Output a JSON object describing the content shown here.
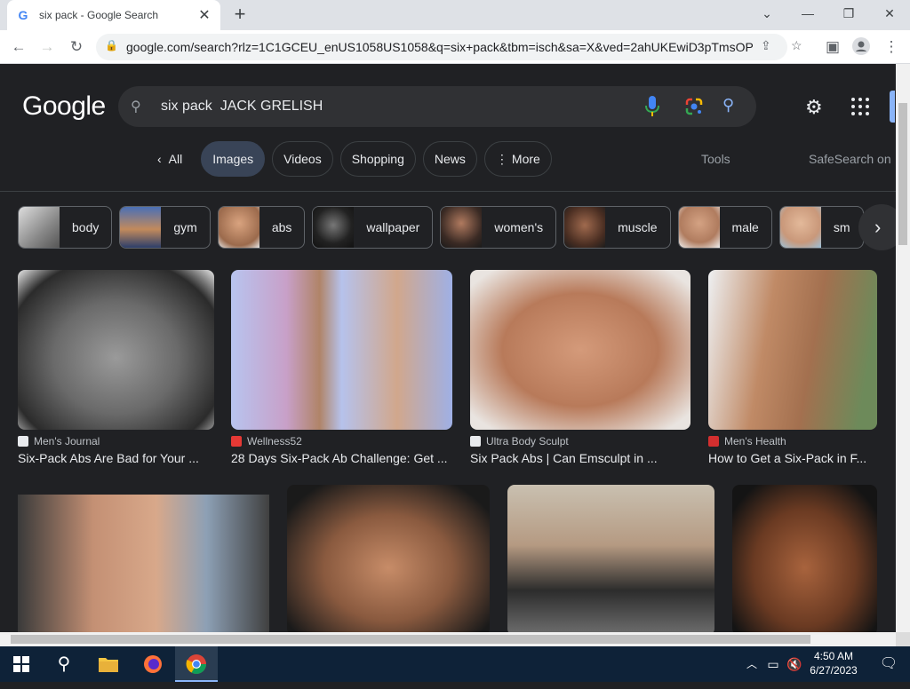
{
  "browser": {
    "tab_title": "six pack - Google Search",
    "tab_close": "✕",
    "new_tab": "+",
    "url": "google.com/search?rlz=1C1GCEU_enUS1058US1058&q=six+pack&tbm=isch&sa=X&ved=2ahUKEwiD3pTmsOP..."
  },
  "google": {
    "logo": "Google",
    "query": "six pack  JACK GRELISH",
    "tabs": [
      "All",
      "Images",
      "Videos",
      "Shopping",
      "News",
      "More"
    ],
    "tools": "Tools",
    "safesearch": "SafeSearch on",
    "chips": [
      "body",
      "gym",
      "abs",
      "wallpaper",
      "women's",
      "muscle",
      "male",
      "sm"
    ],
    "results_row1": [
      {
        "source": "Men's Journal",
        "title": "Six-Pack Abs Are Bad for Your ..."
      },
      {
        "source": "Wellness52",
        "title": "28 Days Six-Pack Ab Challenge: Get ..."
      },
      {
        "source": "Ultra Body Sculpt",
        "title": "Six Pack Abs | Can Emsculpt in ..."
      },
      {
        "source": "Men's Health",
        "title": "How to Get a Six-Pack in F..."
      }
    ]
  },
  "taskbar": {
    "time": "4:50 AM",
    "date": "6/27/2023"
  },
  "colors": {
    "page_bg": "#202124",
    "search_bg": "#303134",
    "active_tab": "#394457",
    "accent_blue": "#8ab4f8",
    "taskbar": "#0e2238"
  }
}
